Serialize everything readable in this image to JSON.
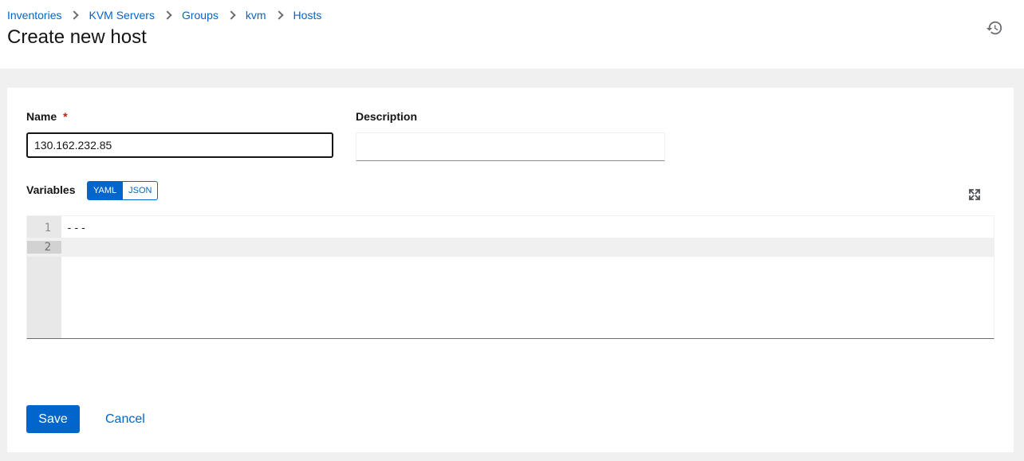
{
  "breadcrumb": {
    "items": [
      "Inventories",
      "KVM Servers",
      "Groups",
      "kvm",
      "Hosts"
    ]
  },
  "page": {
    "title": "Create new host"
  },
  "form": {
    "name_label": "Name",
    "required_marker": "*",
    "name_value": "130.162.232.85",
    "description_label": "Description",
    "description_value": "",
    "variables_label": "Variables",
    "format_options": [
      "YAML",
      "JSON"
    ],
    "selected_format": "YAML"
  },
  "editor": {
    "lines": [
      {
        "number": "1",
        "text": "---"
      },
      {
        "number": "2",
        "text": ""
      }
    ]
  },
  "actions": {
    "save_label": "Save",
    "cancel_label": "Cancel"
  },
  "icons": {
    "history": "history-icon",
    "expand": "expand-icon",
    "breadcrumb_separator": "chevron-right-icon"
  },
  "colors": {
    "accent": "#0066cc",
    "required": "#c9190b",
    "page_background": "#f0f0f0"
  }
}
